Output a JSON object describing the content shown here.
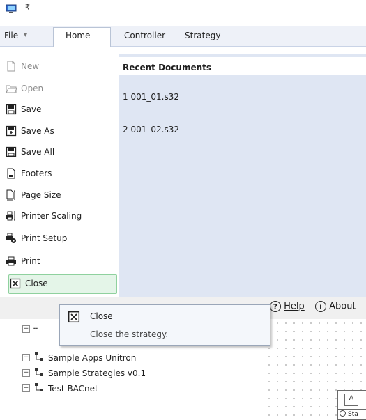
{
  "menubar": {
    "file": "File",
    "home": "Home",
    "controller": "Controller",
    "strategy": "Strategy"
  },
  "backstage": {
    "items": [
      {
        "label": "New",
        "icon": "new-document-icon",
        "enabled": false
      },
      {
        "label": "Open",
        "icon": "open-folder-icon",
        "enabled": false
      },
      {
        "label": "Save",
        "icon": "save-icon",
        "enabled": true
      },
      {
        "label": "Save As",
        "icon": "save-as-icon",
        "enabled": true
      },
      {
        "label": "Save All",
        "icon": "save-all-icon",
        "enabled": true
      },
      {
        "label": "Footers",
        "icon": "footers-icon",
        "enabled": true
      },
      {
        "label": "Page Size",
        "icon": "page-size-icon",
        "enabled": true
      },
      {
        "label": "Printer Scaling",
        "icon": "printer-scaling-icon",
        "enabled": true
      },
      {
        "label": "Print Setup",
        "icon": "print-setup-icon",
        "enabled": true
      },
      {
        "label": "Print",
        "icon": "print-icon",
        "enabled": true
      },
      {
        "label": "Close",
        "icon": "close-doc-icon",
        "enabled": true,
        "selected": true
      }
    ]
  },
  "recent": {
    "title": "Recent Documents",
    "items": [
      {
        "label": "1 001_01.s32"
      },
      {
        "label": "2 001_02.s32"
      }
    ]
  },
  "helpbar": {
    "help": "Help",
    "about": "About"
  },
  "tooltip": {
    "title": "Close",
    "description": "Close the strategy."
  },
  "tree": {
    "items": [
      {
        "label": "Sample Apps Unitron"
      },
      {
        "label": "Sample Strategies v0.1"
      },
      {
        "label": "Test BACnet"
      }
    ]
  },
  "canvas": {
    "block_label": "A",
    "block_status": "Sta"
  },
  "colors": {
    "menubar_bg": "#eef1f8",
    "recent_bg": "#dfe6f3",
    "selected_bg": "#e4f5e8",
    "selected_border": "#8fd19e"
  }
}
